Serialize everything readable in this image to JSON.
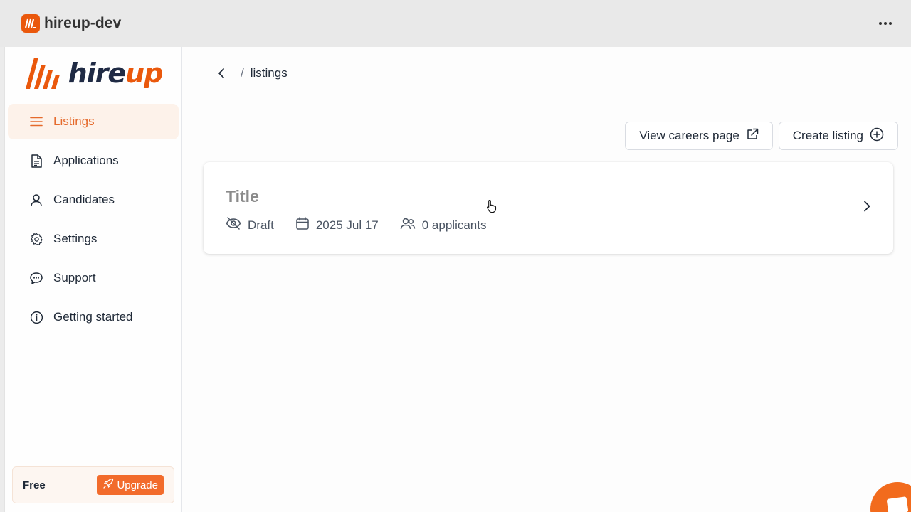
{
  "app": {
    "title": "hireup-dev"
  },
  "brand": {
    "wordmark_dark": "hire",
    "wordmark_accent": "up"
  },
  "sidebar": {
    "items": [
      {
        "label": "Listings",
        "icon": "menu-icon",
        "active": true
      },
      {
        "label": "Applications",
        "icon": "document-icon",
        "active": false
      },
      {
        "label": "Candidates",
        "icon": "user-icon",
        "active": false
      },
      {
        "label": "Settings",
        "icon": "gear-icon",
        "active": false
      },
      {
        "label": "Support",
        "icon": "chat-icon",
        "active": false
      },
      {
        "label": "Getting started",
        "icon": "info-icon",
        "active": false
      }
    ],
    "plan": {
      "label": "Free",
      "upgrade_label": "Upgrade"
    }
  },
  "header": {
    "breadcrumb_separator": "/",
    "breadcrumb": "listings"
  },
  "actions": {
    "careers_label": "View careers page",
    "create_label": "Create listing"
  },
  "listings": [
    {
      "title": "Title",
      "status": "Draft",
      "date": "2025 Jul 17",
      "applicants": "0 applicants"
    }
  ],
  "colors": {
    "accent": "#f26b2b",
    "active_bg": "#fdf2ea",
    "active_text": "#e56a2c"
  }
}
